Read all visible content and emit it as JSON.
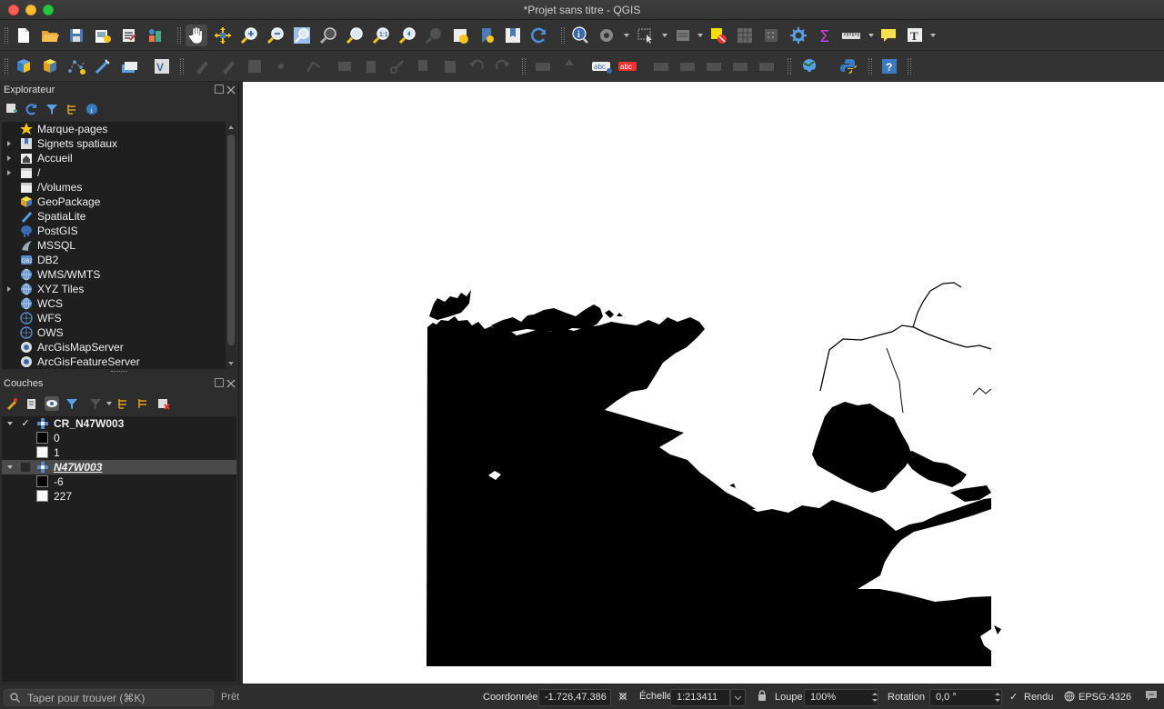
{
  "window": {
    "title": "*Projet sans titre - QGIS"
  },
  "browser_panel": {
    "title": "Explorateur",
    "items": [
      {
        "label": "Marque-pages",
        "icon": "star-icon",
        "expandable": false
      },
      {
        "label": "Signets spatiaux",
        "icon": "bookmark-icon",
        "expandable": true
      },
      {
        "label": "Accueil",
        "icon": "home-folder-icon",
        "expandable": true
      },
      {
        "label": "/",
        "icon": "folder-icon",
        "expandable": true
      },
      {
        "label": "/Volumes",
        "icon": "folder-icon",
        "expandable": false
      },
      {
        "label": "GeoPackage",
        "icon": "geopackage-icon",
        "expandable": false
      },
      {
        "label": "SpatiaLite",
        "icon": "spatialite-icon",
        "expandable": false
      },
      {
        "label": "PostGIS",
        "icon": "postgis-icon",
        "expandable": false
      },
      {
        "label": "MSSQL",
        "icon": "mssql-icon",
        "expandable": false
      },
      {
        "label": "DB2",
        "icon": "db2-icon",
        "expandable": false
      },
      {
        "label": "WMS/WMTS",
        "icon": "globe-icon",
        "expandable": false
      },
      {
        "label": "XYZ Tiles",
        "icon": "globe-icon",
        "expandable": true
      },
      {
        "label": "WCS",
        "icon": "globe-icon",
        "expandable": false
      },
      {
        "label": "WFS",
        "icon": "globe-icon",
        "expandable": false
      },
      {
        "label": "OWS",
        "icon": "globe-icon",
        "expandable": false
      },
      {
        "label": "ArcGisMapServer",
        "icon": "arcgis-icon",
        "expandable": false
      },
      {
        "label": "ArcGisFeatureServer",
        "icon": "arcgis-icon",
        "expandable": false
      }
    ]
  },
  "layers_panel": {
    "title": "Couches",
    "layers": [
      {
        "name": "CR_N47W003",
        "checked": true,
        "checkmark": "✓",
        "selected": false,
        "legend": [
          {
            "value": "0",
            "color": "#000000"
          },
          {
            "value": "1",
            "color": "#ffffff"
          }
        ]
      },
      {
        "name": "N47W003",
        "checked": false,
        "checkmark": "",
        "selected": true,
        "legend": [
          {
            "value": "-6",
            "color": "#000000"
          },
          {
            "value": "227",
            "color": "#ffffff"
          }
        ]
      }
    ]
  },
  "statusbar": {
    "search_placeholder": "Taper pour trouver (⌘K)",
    "ready_text": "Prêt",
    "coord_label": "Coordonnée",
    "coord_value": "-1.726,47.386",
    "scale_label": "Échelle",
    "scale_value": "1:213411",
    "magnifier_label": "Loupe",
    "magnifier_value": "100%",
    "rotation_label": "Rotation",
    "rotation_value": "0,0 °",
    "render_label": "Rendu",
    "render_checked": "✓",
    "crs": "EPSG:4326"
  },
  "colors": {
    "background": "#2b2b2b",
    "map": "#ffffff",
    "land": "#000000",
    "selection": "#4a4a4a"
  }
}
